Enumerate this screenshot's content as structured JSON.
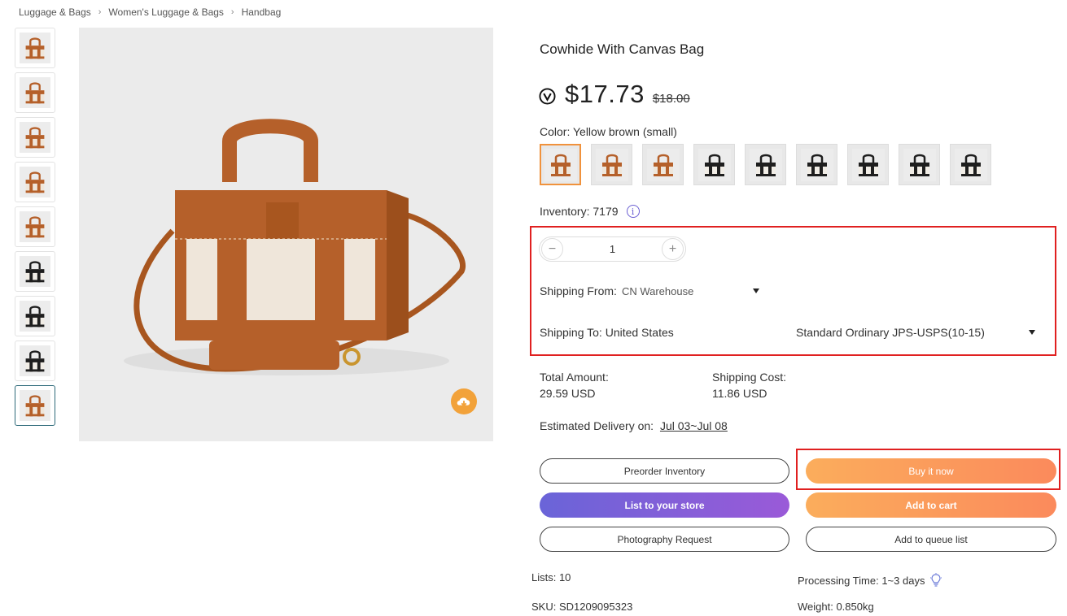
{
  "breadcrumb": [
    "Luggage & Bags",
    "Women's Luggage & Bags",
    "Handbag"
  ],
  "product": {
    "title": "Cowhide With Canvas Bag",
    "price": "$17.73",
    "old_price": "$18.00",
    "color_label": "Color: Yellow brown (small)",
    "inventory": "Inventory: 7179",
    "info_icon_glyph": "i"
  },
  "quantity": {
    "value": "1",
    "minus": "−",
    "plus": "+"
  },
  "shipping": {
    "from_label": "Shipping From:",
    "from_value": "CN Warehouse",
    "to_label": "Shipping To:",
    "to_value": "United States",
    "method": "Standard Ordinary JPS-USPS(10-15)"
  },
  "totals": {
    "total_label": "Total Amount:",
    "total_value": "29.59 USD",
    "shipping_label": "Shipping Cost:",
    "shipping_value": "11.86 USD"
  },
  "delivery": {
    "label": "Estimated Delivery on:",
    "date": "Jul 03~Jul 08"
  },
  "buttons": {
    "preorder": "Preorder Inventory",
    "buy_now": "Buy it now",
    "list_store": "List to your store",
    "add_cart": "Add to cart",
    "photo_request": "Photography Request",
    "add_queue": "Add to queue list"
  },
  "meta": {
    "lists": "Lists: 10",
    "sku": "SKU: SD1209095323",
    "processing": "Processing Time: 1~3 days",
    "weight": "Weight: 0.850kg"
  },
  "thumbnails": [
    {
      "tone": "brown"
    },
    {
      "tone": "brown"
    },
    {
      "tone": "mixed"
    },
    {
      "tone": "brown"
    },
    {
      "tone": "brown"
    },
    {
      "tone": "black"
    },
    {
      "tone": "black"
    },
    {
      "tone": "black"
    },
    {
      "tone": "brown",
      "active": true
    }
  ],
  "swatches": [
    {
      "tone": "brown",
      "active": true
    },
    {
      "tone": "brown"
    },
    {
      "tone": "brown"
    },
    {
      "tone": "black"
    },
    {
      "tone": "black"
    },
    {
      "tone": "black"
    },
    {
      "tone": "black"
    },
    {
      "tone": "black"
    },
    {
      "tone": "black"
    }
  ],
  "colors": {
    "accent_orange": "#f0923c",
    "highlight_red": "#e02020",
    "purple": "#7a5fd8",
    "leather_brown": "#b5602a"
  },
  "icons": {
    "vip": "v-circle-icon",
    "download": "cloud-download-icon",
    "bulb": "light-bulb-icon",
    "caret": "caret-down-icon"
  }
}
